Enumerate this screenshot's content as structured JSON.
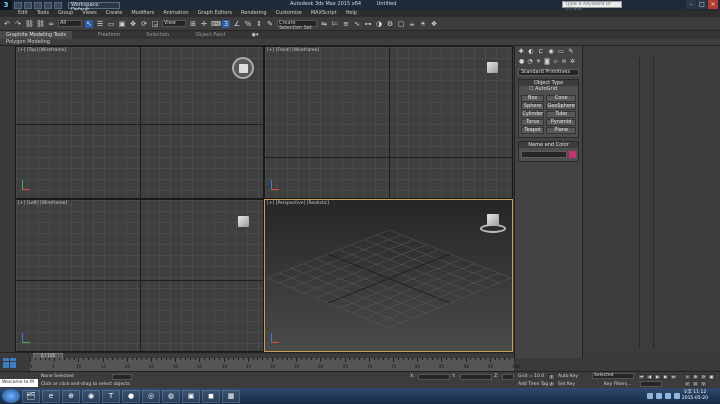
{
  "title_bar": {
    "app_logo": "3",
    "workspace": "Workspace: Default",
    "window_title": "Autodesk 3ds Max 2015 x64",
    "file_name": "Untitled",
    "search_placeholder": "Type a keyword or phrase",
    "controls": [
      "–",
      "□",
      "✕"
    ]
  },
  "menu": [
    "Edit",
    "Tools",
    "Group",
    "Views",
    "Create",
    "Modifiers",
    "Animation",
    "Graph Editors",
    "Rendering",
    "Customize",
    "MAXScript",
    "Help"
  ],
  "toolbar": {
    "filter": "All",
    "ref_coord": "View",
    "named_sel": "Create Selection Set"
  },
  "ribbon": {
    "tabs": [
      "Graphite Modeling Tools",
      "Freeform",
      "Selection",
      "Object Paint"
    ],
    "sub": "Polygon Modeling"
  },
  "viewports": {
    "top": "[+] [Top] [Wireframe]",
    "front": "[+] [Front] [Wireframe]",
    "left": "[+] [Left] [Wireframe]",
    "perspective": "[+] [Perspective] [Realistic]"
  },
  "command_panel": {
    "category": "Standard Primitives",
    "object_type_title": "Object Type",
    "autogrid": "AutoGrid",
    "primitives": [
      "Box",
      "Cone",
      "Sphere",
      "GeoSphere",
      "Cylinder",
      "Tube",
      "Torus",
      "Pyramid",
      "Teapot",
      "Plane"
    ],
    "name_color_title": "Name and Color",
    "swatch_color": "#c9306e"
  },
  "timeline": {
    "frame": "0 / 100",
    "ticks": [
      "0",
      "5",
      "10",
      "15",
      "20",
      "25",
      "30",
      "35",
      "40",
      "45",
      "50",
      "55",
      "60",
      "65",
      "70",
      "75",
      "80",
      "85",
      "90",
      "95",
      "100"
    ]
  },
  "status": {
    "maxscript": "Welcome to M",
    "selection": "None Selected",
    "prompt": "Click or click-and-drag to select objects",
    "x_label": "X:",
    "y_label": "Y:",
    "z_label": "Z:",
    "grid": "Grid = 10.0",
    "add_time_tag": "Add Time Tag",
    "auto_key": "Auto Key",
    "set_key": "Set Key",
    "key_mode": "Selected",
    "key_filters": "Key Filters..."
  },
  "taskbar": {
    "apps": [
      "🗂",
      "e",
      "⊕",
      "◉",
      "T",
      "●",
      "◎",
      "◍",
      "▣",
      "◼",
      "▦"
    ],
    "time": "오후 11:12",
    "date": "2015-05-20"
  }
}
